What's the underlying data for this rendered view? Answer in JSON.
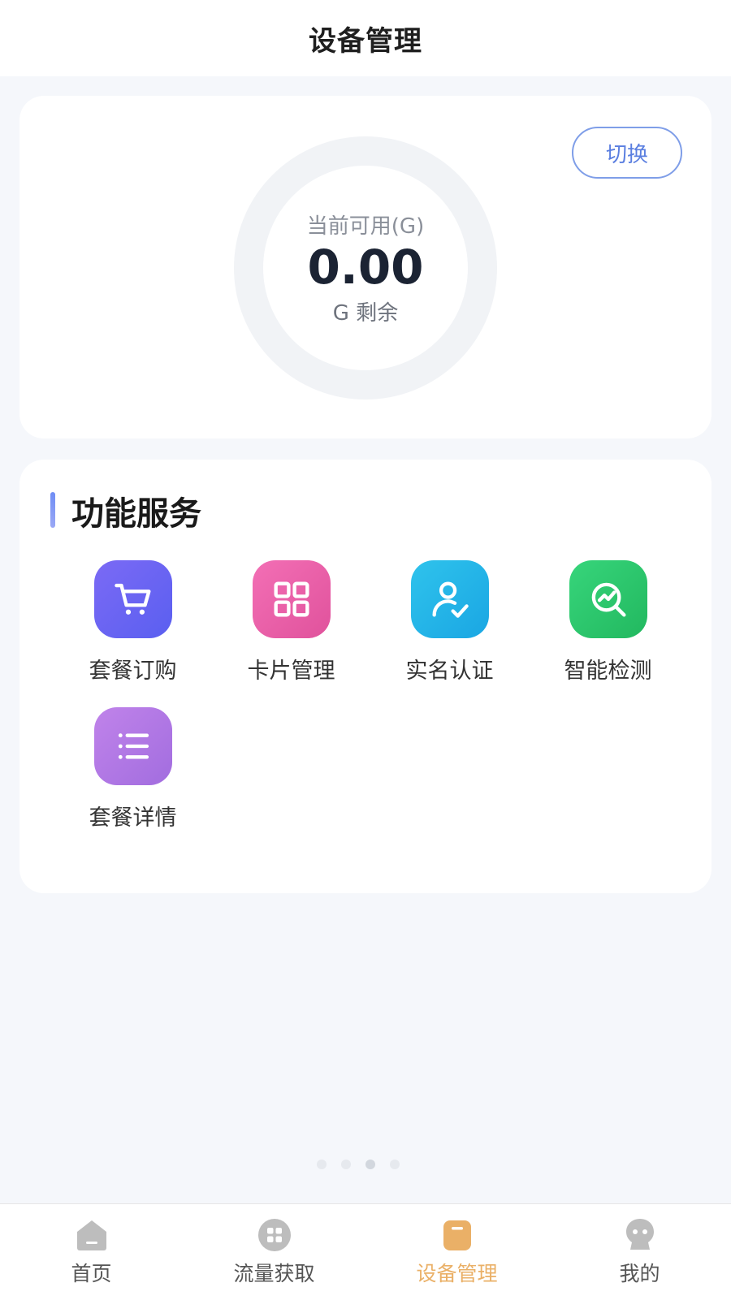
{
  "header": {
    "title": "设备管理"
  },
  "balance": {
    "switch_label": "切换",
    "ring_label": "当前可用(G)",
    "value": "0.00",
    "unit": "G 剩余",
    "ring_fraction": 0
  },
  "services": {
    "title": "功能服务",
    "items": [
      {
        "label": "套餐订购",
        "icon": "cart-icon",
        "color": "#6a66f2"
      },
      {
        "label": "卡片管理",
        "icon": "grid-icon",
        "color": "#ea5fa8"
      },
      {
        "label": "实名认证",
        "icon": "user-check-icon",
        "color": "#24b5e8"
      },
      {
        "label": "智能检测",
        "icon": "chart-search-icon",
        "color": "#2cc66d"
      },
      {
        "label": "套餐详情",
        "icon": "list-icon",
        "color": "#b078e6"
      }
    ]
  },
  "tabbar": {
    "items": [
      {
        "label": "首页",
        "icon": "home-icon",
        "active": false
      },
      {
        "label": "流量获取",
        "icon": "apps-icon",
        "active": false
      },
      {
        "label": "设备管理",
        "icon": "device-icon",
        "active": true
      },
      {
        "label": "我的",
        "icon": "profile-icon",
        "active": false
      }
    ],
    "active_color": "#eab067",
    "inactive_color": "#bdbdbd"
  }
}
